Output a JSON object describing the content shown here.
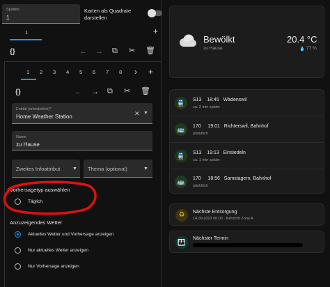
{
  "editor": {
    "spalten_label": "Spalten",
    "spalten_value": "1",
    "square_label_line1": "Karten als Quadrate",
    "square_label_line2": "darstellen",
    "outer_tab": "1",
    "outer_add": "+",
    "inner_tabs": [
      "1",
      "2",
      "3",
      "4",
      "5",
      "6",
      "7",
      "8"
    ],
    "inner_next": "›",
    "inner_add": "+",
    "entity_label": "Entität (erforderlich)*",
    "entity_value": "Home Weather Station",
    "name_label": "Name",
    "name_value": "zu Hause",
    "second_info_placeholder": "Zweites Infoattribut",
    "theme_placeholder": "Thema (optional)",
    "forecast_type_title": "Vorhersagetyp auswählen",
    "forecast_type_option": "Täglich",
    "display_title": "Anzuzeigendes Wetter",
    "display_options": [
      {
        "label": "Aktuelles Wetter und Vorhersage anzeigen",
        "selected": true
      },
      {
        "label": "Nur aktuelles Wetter anzeigen",
        "selected": false
      },
      {
        "label": "Nur Vorhersage anzeigen",
        "selected": false
      }
    ]
  },
  "weather": {
    "condition": "Bewölkt",
    "location": "zu Hause",
    "temperature": "20.4 °C",
    "humidity": "77 %"
  },
  "departures": [
    {
      "icon": "train-icon",
      "line": "S13",
      "time": "18:45",
      "dest": "Wädenswil",
      "status": "ca. 2 min später"
    },
    {
      "icon": "bus-icon",
      "line": "170",
      "time": "19:01",
      "dest": "Richterswil, Bahnhof",
      "status": "pünktlich"
    },
    {
      "icon": "train-icon",
      "line": "S13",
      "time": "19:13",
      "dest": "Einsiedeln",
      "status": "ca. 1 min später"
    },
    {
      "icon": "bus-icon",
      "line": "170",
      "time": "18:56",
      "dest": "Samstagern, Bahnhof",
      "status": "pünktlich"
    }
  ],
  "waste": {
    "title": "Nächste Entsorgung",
    "detail": "14.09.2023 00:00 · Kehricht Zone A"
  },
  "appointment": {
    "title": "Nächster Termin"
  },
  "colors": {
    "accent": "#2196f3",
    "annotation": "#e01010",
    "transit_green": "#4caf50",
    "waste_yellow": "#d7b11a",
    "appointment_teal": "#26a69a"
  }
}
